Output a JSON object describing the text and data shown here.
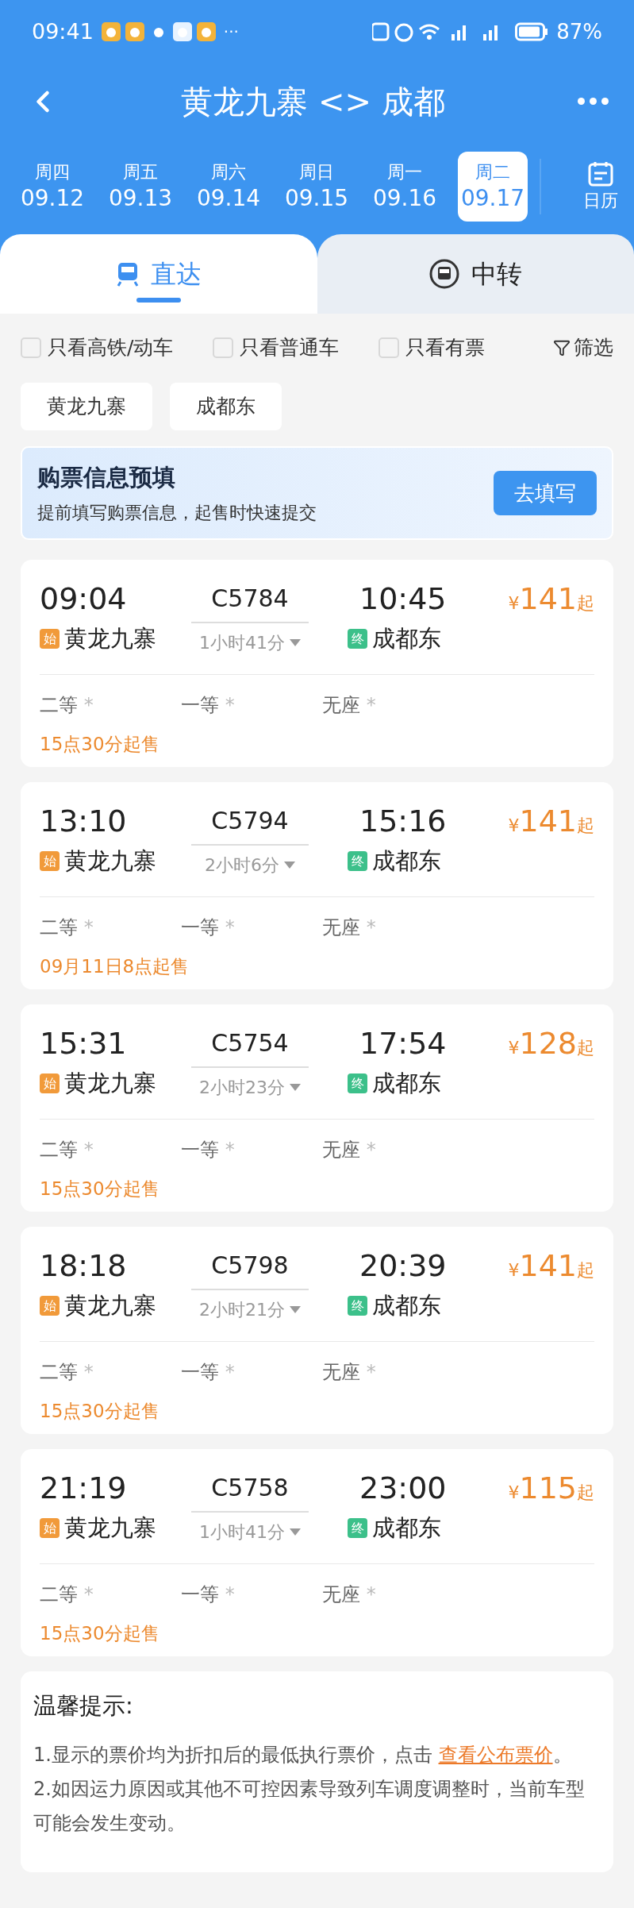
{
  "status_bar": {
    "time": "09:41",
    "more": "···",
    "battery": "87%"
  },
  "header": {
    "title": "黄龙九寨 <> 成都"
  },
  "dates": [
    {
      "weekday": "周四",
      "date": "09.12",
      "selected": false
    },
    {
      "weekday": "周五",
      "date": "09.13",
      "selected": false
    },
    {
      "weekday": "周六",
      "date": "09.14",
      "selected": false
    },
    {
      "weekday": "周日",
      "date": "09.15",
      "selected": false
    },
    {
      "weekday": "周一",
      "date": "09.16",
      "selected": false
    },
    {
      "weekday": "周二",
      "date": "09.17",
      "selected": true
    }
  ],
  "calendar_label": "日历",
  "tabs": [
    {
      "label": "直达",
      "kind": "direct",
      "selected": true
    },
    {
      "label": "中转",
      "kind": "transfer",
      "selected": false
    }
  ],
  "filters": [
    {
      "label": "只看高铁/动车",
      "checked": false
    },
    {
      "label": "只看普通车",
      "checked": false
    },
    {
      "label": "只看有票",
      "checked": false
    }
  ],
  "filter_button": "筛选",
  "stations": [
    "黄龙九寨",
    "成都东"
  ],
  "prefill": {
    "title": "购票信息预填",
    "subtitle": "提前填写购票信息，起售时快速提交",
    "button": "去填写"
  },
  "trains": [
    {
      "depart": "09:04",
      "train_no": "C5784",
      "duration": "1小时41分",
      "arrive": "10:45",
      "currency": "¥",
      "price": "141",
      "price_suffix": "起",
      "from_badge": "始",
      "from": "黄龙九寨",
      "to_badge": "终",
      "to": "成都东",
      "seats": [
        {
          "name": "二等",
          "avail": "*"
        },
        {
          "name": "一等",
          "avail": "*"
        },
        {
          "name": "无座",
          "avail": "*"
        }
      ],
      "sale_note": "15点30分起售"
    },
    {
      "depart": "13:10",
      "train_no": "C5794",
      "duration": "2小时6分",
      "arrive": "15:16",
      "currency": "¥",
      "price": "141",
      "price_suffix": "起",
      "from_badge": "始",
      "from": "黄龙九寨",
      "to_badge": "终",
      "to": "成都东",
      "seats": [
        {
          "name": "二等",
          "avail": "*"
        },
        {
          "name": "一等",
          "avail": "*"
        },
        {
          "name": "无座",
          "avail": "*"
        }
      ],
      "sale_note": "09月11日8点起售"
    },
    {
      "depart": "15:31",
      "train_no": "C5754",
      "duration": "2小时23分",
      "arrive": "17:54",
      "currency": "¥",
      "price": "128",
      "price_suffix": "起",
      "from_badge": "始",
      "from": "黄龙九寨",
      "to_badge": "终",
      "to": "成都东",
      "seats": [
        {
          "name": "二等",
          "avail": "*"
        },
        {
          "name": "一等",
          "avail": "*"
        },
        {
          "name": "无座",
          "avail": "*"
        }
      ],
      "sale_note": "15点30分起售"
    },
    {
      "depart": "18:18",
      "train_no": "C5798",
      "duration": "2小时21分",
      "arrive": "20:39",
      "currency": "¥",
      "price": "141",
      "price_suffix": "起",
      "from_badge": "始",
      "from": "黄龙九寨",
      "to_badge": "终",
      "to": "成都东",
      "seats": [
        {
          "name": "二等",
          "avail": "*"
        },
        {
          "name": "一等",
          "avail": "*"
        },
        {
          "name": "无座",
          "avail": "*"
        }
      ],
      "sale_note": "15点30分起售"
    },
    {
      "depart": "21:19",
      "train_no": "C5758",
      "duration": "1小时41分",
      "arrive": "23:00",
      "currency": "¥",
      "price": "115",
      "price_suffix": "起",
      "from_badge": "始",
      "from": "黄龙九寨",
      "to_badge": "终",
      "to": "成都东",
      "seats": [
        {
          "name": "二等",
          "avail": "*"
        },
        {
          "name": "一等",
          "avail": "*"
        },
        {
          "name": "无座",
          "avail": "*"
        }
      ],
      "sale_note": "15点30分起售"
    }
  ],
  "notice": {
    "title": "温馨提示:",
    "items": [
      {
        "text": "1.显示的票价均为折扣后的最低执行票价，点击 ",
        "link": "查看公布票价",
        "tail": "。"
      },
      {
        "text": "2.如因运力原因或其他不可控因素导致列车调度调整时，当前车型可能会发生变动。"
      }
    ]
  }
}
